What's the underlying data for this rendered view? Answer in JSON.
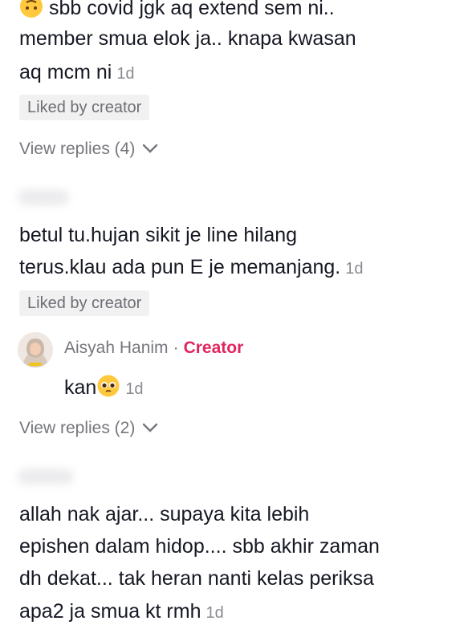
{
  "comment1": {
    "lines": [
      "sbb covid jgk aq extend sem ni..",
      "member smua elok ja.. knapa kwasan",
      "aq mcm ni"
    ],
    "time": "1d",
    "liked_label": "Liked by creator",
    "view_replies": "View replies (4)"
  },
  "comment2": {
    "lines": [
      "betul tu.hujan sikit je line hilang",
      "terus.klau ada pun E je memanjang."
    ],
    "time": "1d",
    "liked_label": "Liked by creator"
  },
  "creator_reply": {
    "name": "Aisyah Hanim",
    "separator": "·",
    "tag": "Creator",
    "text": "kan",
    "emoji": "pleading-face-emoji",
    "time": "1d",
    "view_replies": "View replies (2)"
  },
  "comment3": {
    "lines": [
      "allah nak ajar... supaya kita lebih",
      "epishen dalam hidop.... sbb akhir zaman",
      "dh dekat... tak heran nanti kelas periksa",
      "apa2 ja smua kt rmh"
    ],
    "time": "1d"
  },
  "colors": {
    "creator_accent": "#e0245e",
    "text": "#161823",
    "muted": "#8a8b91"
  }
}
